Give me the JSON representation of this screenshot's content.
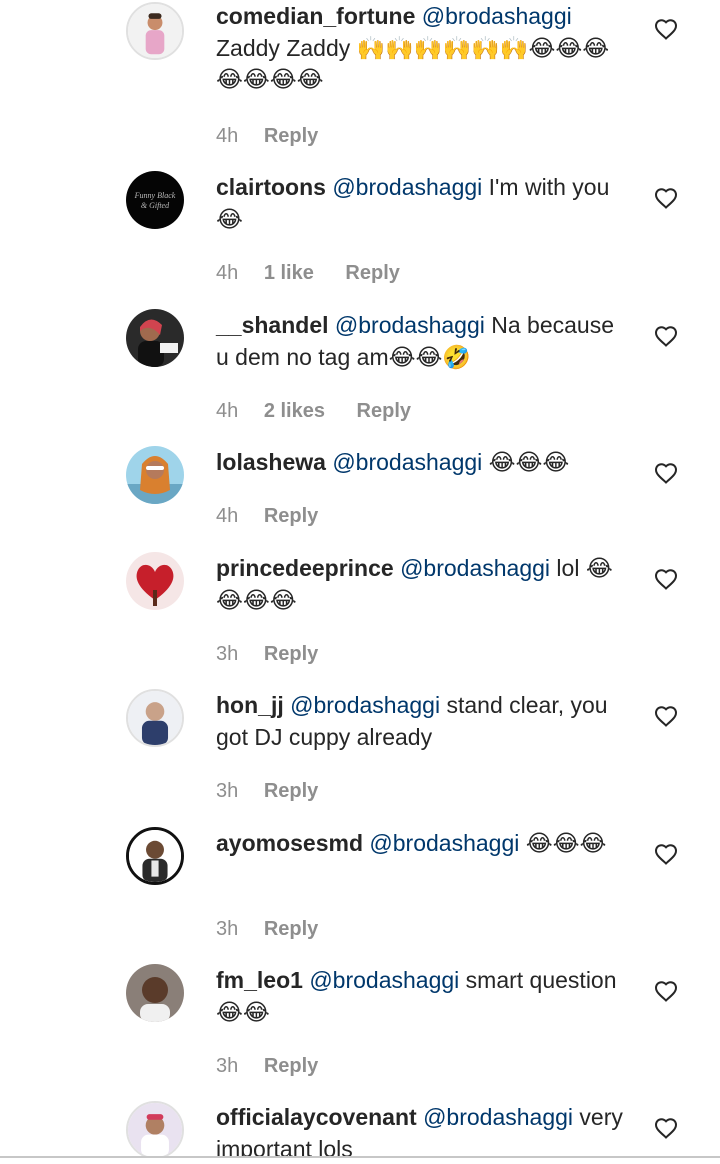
{
  "comments": [
    {
      "username": "comedian_fortune",
      "mention": "@brodashaggi",
      "text": " Zaddy Zaddy 🙌🙌🙌🙌🙌🙌😂😂😂😂😂😂😂",
      "time": "4h",
      "likes": "",
      "reply": "Reply",
      "avatar_icon": "avatar-comedian-fortune"
    },
    {
      "username": "clairtoons",
      "mention": "@brodashaggi",
      "text": " I'm with you😂",
      "time": "4h",
      "likes": "1 like",
      "reply": "Reply",
      "avatar_icon": "avatar-clairtoons"
    },
    {
      "username": "__shandel",
      "mention": "@brodashaggi",
      "text": " Na because u dem no tag am😂😂🤣",
      "time": "4h",
      "likes": "2 likes",
      "reply": "Reply",
      "avatar_icon": "avatar-shandel"
    },
    {
      "username": "lolashewa",
      "mention": "@brodashaggi",
      "text": " 😂😂😂",
      "time": "4h",
      "likes": "",
      "reply": "Reply",
      "avatar_icon": "avatar-lolashewa"
    },
    {
      "username": "princedeeprince",
      "mention": "@brodashaggi",
      "text": " lol 😂😂😂😂",
      "time": "3h",
      "likes": "",
      "reply": "Reply",
      "avatar_icon": "avatar-heart-tree"
    },
    {
      "username": "hon_jj",
      "mention": "@brodashaggi",
      "text": " stand clear, you got DJ cuppy already",
      "time": "3h",
      "likes": "",
      "reply": "Reply",
      "avatar_icon": "avatar-hon-jj"
    },
    {
      "username": "ayomosesmd",
      "mention": "@brodashaggi",
      "text": " 😂😂😂",
      "time": "3h",
      "likes": "",
      "reply": "Reply",
      "avatar_icon": "avatar-ayomosesmd"
    },
    {
      "username": "fm_leo1",
      "mention": "@brodashaggi",
      "text": " smart question😂😂",
      "time": "3h",
      "likes": "",
      "reply": "Reply",
      "avatar_icon": "avatar-fm-leo1"
    },
    {
      "username": "officialaycovenant",
      "mention": "@brodashaggi",
      "text": " very important lols",
      "time": "",
      "likes": "",
      "reply": "",
      "avatar_icon": "avatar-officialaycovenant"
    }
  ],
  "icons": {
    "like": "heart-outline-icon"
  },
  "colors": {
    "text": "#262626",
    "mention": "#00376b",
    "meta": "#8e8e8e"
  }
}
